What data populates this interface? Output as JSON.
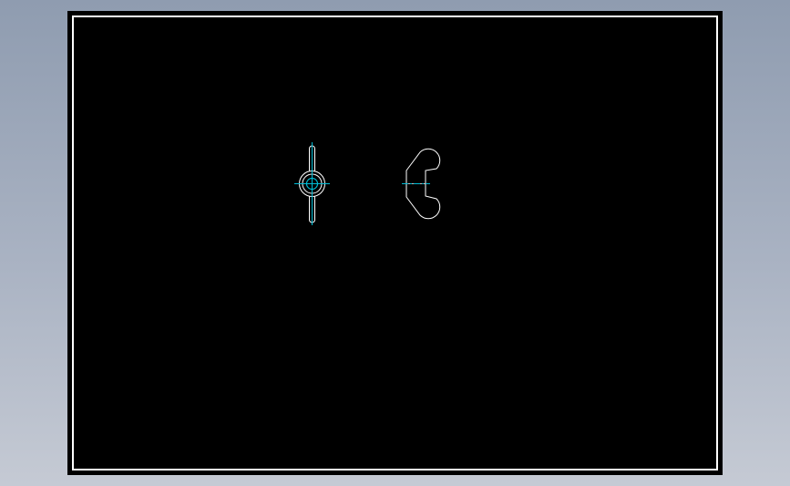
{
  "colors": {
    "background_top": "#8f9cb0",
    "background_bottom": "#c5cad4",
    "sheet": "#000000",
    "border": "#ffffff",
    "outline": "#ffffff",
    "centerline": "#00bcd4"
  },
  "views": [
    {
      "name": "wing-nut-front-view"
    },
    {
      "name": "wing-nut-side-view"
    }
  ]
}
